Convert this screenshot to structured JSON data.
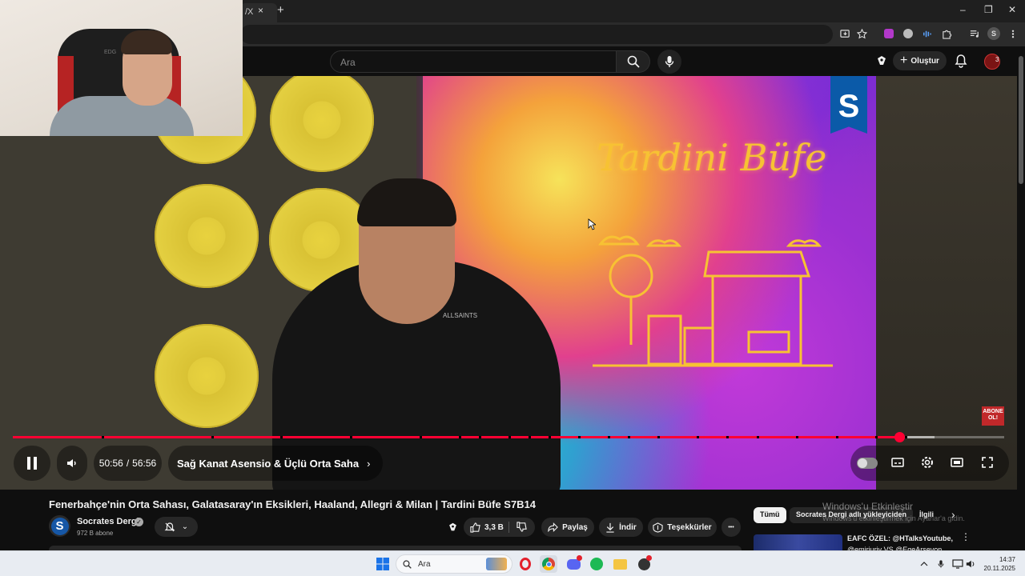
{
  "browser": {
    "tab_title": "/X",
    "tab_close": "×",
    "new_tab": "+",
    "window_controls": [
      "–",
      "❐",
      "✕"
    ],
    "profile_initial": "S"
  },
  "youtube": {
    "search_placeholder": "Ara",
    "create_label": "Oluştur",
    "notification_badge": "3"
  },
  "webcam": {
    "chair_text": "EDG"
  },
  "video": {
    "show_title": "Tardini Büfe",
    "logo_letter": "S",
    "subscribe_badge": "ABONE OL!",
    "shirt_text": "ALLSAINTS",
    "time_current": "50:56",
    "time_separator": "/",
    "time_total": "56:56",
    "chapter_title": "Sağ Kanat Asensio & Üçlü Orta Saha",
    "progress_fraction": 0.8945,
    "buffered_fraction": 0.93,
    "chapter_boundaries": [
      0.09,
      0.2,
      0.27,
      0.34,
      0.41,
      0.45,
      0.47,
      0.5,
      0.52,
      0.54,
      0.57,
      0.6,
      0.62,
      0.65,
      0.69,
      0.72,
      0.75,
      0.79,
      0.83,
      0.87,
      0.9
    ]
  },
  "details": {
    "title": "Fenerbahçe'nin Orta Sahası, Galatasaray'ın Eksikleri, Haaland, Allegri & Milan | Tardini Büfe S7B14",
    "channel_name": "Socrates Dergi",
    "channel_avatar_letter": "S",
    "subscribers": "972 B abone",
    "like_count": "3,3 B",
    "share_label": "Paylaş",
    "download_label": "İndir",
    "thanks_label": "Teşekkürler",
    "more_label": "•••"
  },
  "recommendations": {
    "chips": [
      "Tümü",
      "Socrates Dergi adlı yükleyiciden",
      "İlgili"
    ],
    "first_title": "EAFC ÖZEL: @HTalksYoutube,",
    "first_title_line2": "@emirjuriv VS @EgeArsevon"
  },
  "windows_watermark": {
    "line1": "Windows'u Etkinleştir",
    "line2": "Windows'u etkinleştirmek için Ayarlar'a gidin."
  },
  "taskbar": {
    "search_placeholder": "Ara",
    "time": "14:37",
    "date": "20.11.2025"
  },
  "colors": {
    "accent_red": "#ff0033",
    "show_title_yellow": "#f7c233"
  }
}
